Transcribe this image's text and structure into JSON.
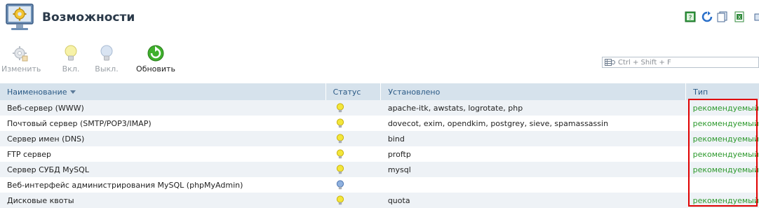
{
  "header": {
    "title": "Возможности"
  },
  "toolbar": {
    "edit_label": "Изменить",
    "on_label": "Вкл.",
    "off_label": "Выкл.",
    "refresh_label": "Обновить"
  },
  "search": {
    "placeholder": "Ctrl + Shift + F"
  },
  "table": {
    "headers": {
      "name": "Наименование",
      "status": "Статус",
      "installed": "Установлено",
      "type": "Тип"
    },
    "rows": [
      {
        "name": "Веб-сервер (WWW)",
        "status": "on",
        "installed": "apache-itk, awstats, logrotate, php",
        "type": "рекомендуемый"
      },
      {
        "name": "Почтовый сервер (SMTP/POP3/IMAP)",
        "status": "on",
        "installed": "dovecot, exim, opendkim, postgrey, sieve, spamassassin",
        "type": "рекомендуемый"
      },
      {
        "name": "Сервер имен (DNS)",
        "status": "on",
        "installed": "bind",
        "type": "рекомендуемый"
      },
      {
        "name": "FTP сервер",
        "status": "on",
        "installed": "proftp",
        "type": "рекомендуемый"
      },
      {
        "name": "Сервер СУБД MySQL",
        "status": "on",
        "installed": "mysql",
        "type": "рекомендуемый"
      },
      {
        "name": "Веб-интерфейс администрирования MySQL (phpMyAdmin)",
        "status": "off",
        "installed": "",
        "type": ""
      },
      {
        "name": "Дисковые квоты",
        "status": "on",
        "installed": "quota",
        "type": "рекомендуемый"
      }
    ]
  },
  "colors": {
    "type_link": "#2e9a2e",
    "header_bg": "#d6e2ec",
    "highlight": "#e00000"
  }
}
